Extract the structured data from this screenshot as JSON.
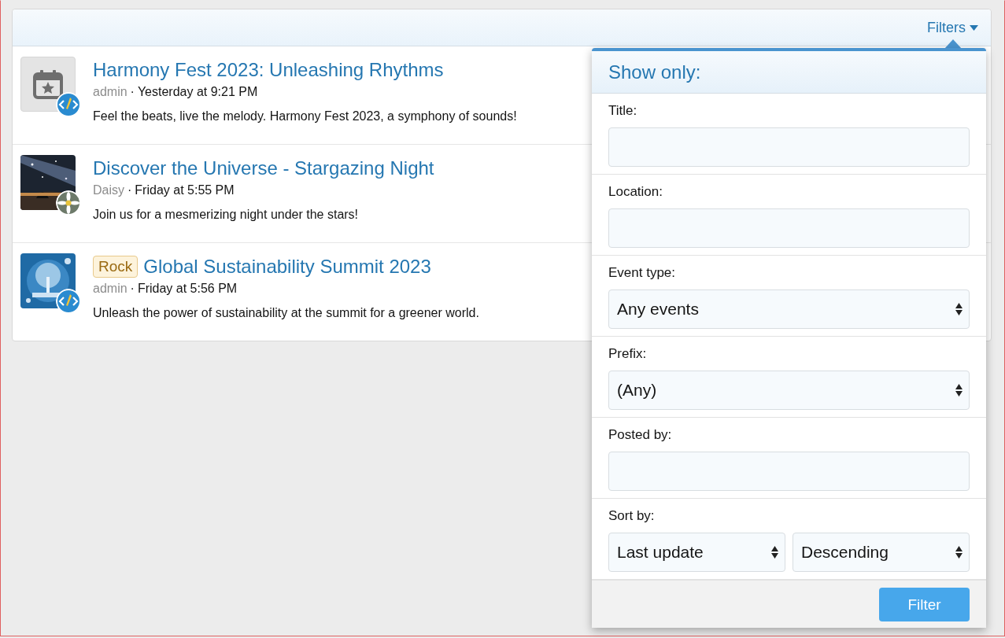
{
  "header": {
    "filters_button": "Filters"
  },
  "events": [
    {
      "thumbnail": {
        "kind": "calendar"
      },
      "avatar": {
        "kind": "emblem"
      },
      "title": "Harmony Fest 2023: Unleashing Rhythms",
      "author": "admin",
      "separator": "·",
      "time": "Yesterday at 9:21 PM",
      "snippet": "Feel the beats, live the melody. Harmony Fest 2023, a symphony of sounds!"
    },
    {
      "title": "Discover the Universe - Stargazing Night",
      "author": "Daisy",
      "separator": "·",
      "time": "Friday at 5:55 PM",
      "snippet": "Join us for a mesmerizing night under the stars!"
    },
    {
      "avatar": {
        "kind": "emblem"
      },
      "prefix": "Rock",
      "title": "Global Sustainability Summit 2023",
      "author": "admin",
      "separator": "·",
      "time": "Friday at 5:56 PM",
      "snippet": "Unleash the power of sustainability at the summit for a greener world."
    }
  ],
  "filter_menu": {
    "heading": "Show only:",
    "fields": [
      {
        "kind": "text",
        "label": "Title:"
      },
      {
        "kind": "text",
        "label": "Location:"
      },
      {
        "kind": "select",
        "label": "Event type:",
        "value": "Any events"
      },
      {
        "kind": "select",
        "label": "Prefix:",
        "value": "(Any)"
      },
      {
        "kind": "text",
        "label": "Posted by:"
      },
      {
        "kind": "pair",
        "label": "Sort by:",
        "values": [
          "Last update",
          "Descending"
        ]
      }
    ],
    "submit": "Filter"
  }
}
